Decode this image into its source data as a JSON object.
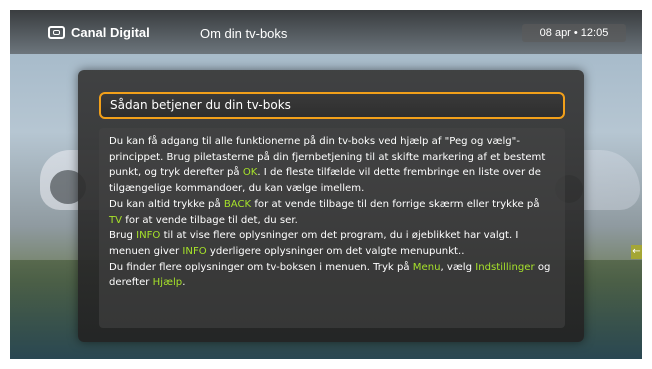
{
  "header": {
    "brand": "Canal Digital",
    "title": "Om din tv-boks",
    "datetime": "08 apr • 12:05"
  },
  "panel": {
    "title": "Sådan betjener du din tv-boks",
    "p1_a": "Du kan få adgang til alle funktionerne på din tv-boks ved hjælp af \"Peg og vælg\"-princippet. Brug piletasterne på din fjernbetjening til at skifte markering af et bestemt punkt, og tryk derefter på ",
    "p1_ok": "OK",
    "p1_b": ". I de fleste tilfælde vil dette frembringe en liste over de tilgængelige kommandoer, du kan vælge imellem.",
    "p2_a": "Du kan altid trykke på ",
    "p2_back": "BACK",
    "p2_b": " for at vende tilbage til den forrige skærm eller trykke på ",
    "p2_tv": "TV",
    "p2_c": " for at vende tilbage til det, du ser.",
    "p3_a": "Brug ",
    "p3_info1": "INFO",
    "p3_b": " til at vise flere oplysninger om det program, du i øjeblikket har valgt. I menuen giver ",
    "p3_info2": "INFO",
    "p3_c": " yderligere oplysninger om det valgte menupunkt..",
    "p4_a": "Du finder flere oplysninger om tv-boksen i menuen. Tryk på ",
    "p4_menu": "Menu",
    "p4_b": ", vælg ",
    "p4_settings": "Indstillinger",
    "p4_c": " og derefter ",
    "p4_help": "Hjælp",
    "p4_d": "."
  },
  "icons": {
    "brand": "tv-logo-icon",
    "scroll": "arrow-left-icon"
  },
  "colors": {
    "focus_border": "#f2a01a",
    "highlight": "#a6e22a"
  }
}
